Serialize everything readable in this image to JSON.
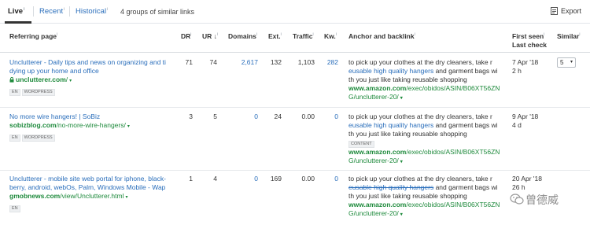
{
  "tabs": {
    "live": "Live",
    "recent": "Recent",
    "historical": "Historical",
    "info": "i"
  },
  "groups_text": "4 groups of similar links",
  "export_label": "Export",
  "columns": {
    "referring_page": "Referring page",
    "dr": "DR",
    "ur": "UR",
    "domains": "Domains",
    "ext": "Ext.",
    "traffic": "Traffic",
    "kw": "Kw.",
    "anchor": "Anchor and backlink",
    "first_seen": "First seen",
    "last_check": "Last check",
    "similar": "Similar",
    "info": "i",
    "ur_sort": "↓"
  },
  "rows": [
    {
      "title_line1": "Unclutterer - Daily tips and news on organizing and ti",
      "title_line2": "dying up your home and office",
      "domain": "unclutterer.com",
      "path": "/",
      "tags": [
        "EN",
        "WORDPRESS"
      ],
      "dr": "71",
      "ur": "74",
      "domains": "2,617",
      "ext": "132",
      "traffic": "1,103",
      "kw": "282",
      "anchor_pre": "to pick up your clothes at the dry cleaners, take r",
      "anchor_link": "eusable high quality hangers",
      "anchor_mid": " and garment bags wi",
      "anchor_post": "th you just like taking reusable shopping",
      "content_tag": "",
      "target_domain": "www.amazon.com",
      "target_path1": "/exec/obidos/ASIN/B06XT56ZN",
      "target_path2": "G/unclutterer-20/",
      "first_seen": "7 Apr '18",
      "last_check": "2 h",
      "similar": "5"
    },
    {
      "title_line1": "No more wire hangers! | SoBiz",
      "title_line2": "",
      "domain": "sobizblog.com",
      "path": "/no-more-wire-hangers/",
      "tags": [
        "EN",
        "WORDPRESS"
      ],
      "dr": "3",
      "ur": "5",
      "domains": "0",
      "ext": "24",
      "traffic": "0.00",
      "kw": "0",
      "anchor_pre": "to pick up your clothes at the dry cleaners, take r",
      "anchor_link": "eusable high quality hangers",
      "anchor_mid": " and garment bags wi",
      "anchor_post": "th you just like taking reusable shopping",
      "content_tag": "CONTENT",
      "target_domain": "www.amazon.com",
      "target_path1": "/exec/obidos/ASIN/B06XT56ZN",
      "target_path2": "G/unclutterer-20/",
      "first_seen": "9 Apr '18",
      "last_check": "4 d",
      "similar": ""
    },
    {
      "title_line1": "Unclutterer - mobile site web portal for iphone, black-",
      "title_line2": "berry, android, webOs, Palm, Windows Mobile - Wap",
      "domain": "gmobnews.com",
      "path": "/view/Unclutterer.html",
      "tags": [
        "EN"
      ],
      "dr": "1",
      "ur": "4",
      "domains": "0",
      "ext": "169",
      "traffic": "0.00",
      "kw": "0",
      "anchor_pre": "to pick up your clothes at the dry cleaners, take r",
      "anchor_link": "eusable high quality hangers",
      "anchor_mid": " and garment bags wi",
      "anchor_post": "th you just like taking reusable shopping",
      "content_tag": "",
      "target_domain": "www.amazon.com",
      "target_path1": "/exec/obidos/ASIN/B06XT56ZN",
      "target_path2": "G/unclutterer-20/",
      "first_seen": "20 Apr '18",
      "last_check": "26 h",
      "similar": ""
    }
  ],
  "caret": "▾",
  "watermark": "曾德威",
  "colors": {
    "link": "#2a6ebb",
    "url_green": "#1e8a3c",
    "text": "#333333",
    "border": "#e6e9ec"
  }
}
